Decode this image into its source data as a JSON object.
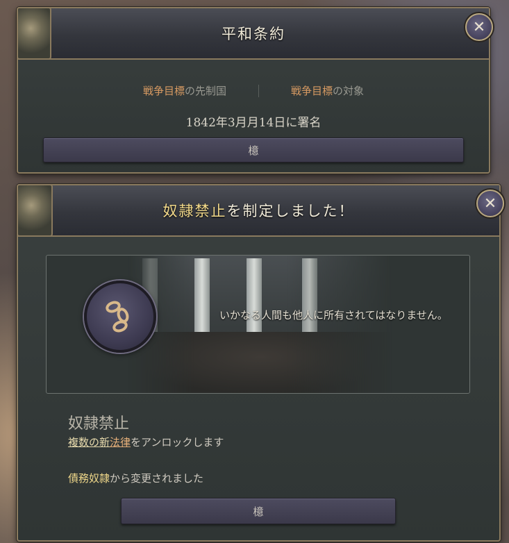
{
  "treaty_panel": {
    "title": "平和条約",
    "war_goal_initiator_prefix": "戦争目標",
    "war_goal_initiator_suffix": "の先制国",
    "war_goal_target_prefix": "戦争目標",
    "war_goal_target_suffix": "の対象",
    "signed_text": "1842年3月月14日に署名",
    "button_label": "檍",
    "close_icon": "close-icon"
  },
  "law_panel": {
    "title_highlight": "奴隷禁止",
    "title_rest": "を制定しました！",
    "description": "いかなる人間も他人に所有されてはなりません。",
    "medal_icon": "broken-chain-icon",
    "law_name": "奴隷禁止",
    "unlock_part1": "複数の新",
    "unlock_part2": "法律",
    "unlock_part3": "をアンロックします",
    "changed_from_highlight": "債務奴隷",
    "changed_from_rest": "から変更されました",
    "button_label": "檍",
    "close_icon": "close-icon"
  },
  "colors": {
    "frame_gold": "#8a7a5e",
    "highlight_yellow": "#f2d98a",
    "war_goal_orange": "#d79a62"
  }
}
